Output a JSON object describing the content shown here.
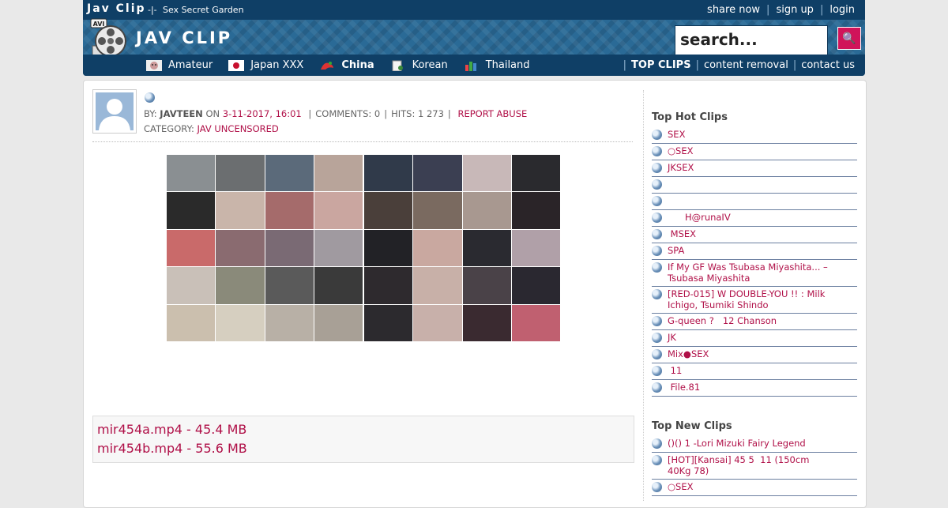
{
  "site": {
    "title": "Jav Clip",
    "separator": "-|-",
    "tagline": "Sex Secret Garden",
    "logo_text": "JAV CLIP",
    "logo_badge": "AVI"
  },
  "top_links": [
    "share now",
    "sign up",
    "login"
  ],
  "search": {
    "placeholder": "search..."
  },
  "nav": {
    "items": [
      {
        "label": "Amateur",
        "icon": "amateur-icon",
        "bold": false
      },
      {
        "label": "Japan XXX",
        "icon": "japan-flag-icon",
        "bold": false
      },
      {
        "label": "China",
        "icon": "china-icon",
        "bold": true
      },
      {
        "label": "Korean",
        "icon": "korean-icon",
        "bold": false
      },
      {
        "label": "Thailand",
        "icon": "thailand-icon",
        "bold": false
      }
    ],
    "right": [
      "TOP CLIPS",
      "content removal",
      "contact us"
    ]
  },
  "post": {
    "by_label": "BY:",
    "author": "JAVTEEN",
    "on_label": "ON",
    "date": "3-11-2017, 16:01",
    "comments": "COMMENTS: 0",
    "hits": "HITS: 1 273",
    "report": "REPORT ABUSE",
    "category_label": "CATEGORY:",
    "category": "JAV UNCENSORED"
  },
  "files": [
    "mir454a.mp4 - 45.4 MB",
    "mir454b.mp4 - 55.6 MB"
  ],
  "sidebar": {
    "hot_title": "Top Hot Clips",
    "hot": [
      "SEX",
      "○SEX",
      "JKSEX",
      "",
      "",
      "      H@runaIV",
      " MSEX",
      "SPA",
      "If My GF Was Tsubasa Miyashita... – Tsubasa Miyashita",
      "[RED-015] W DOUBLE-YOU !! : Milk Ichigo, Tsumiki Shindo",
      "G-queen ?   12 Chanson",
      "JK",
      "Mix●SEX",
      " 11",
      " File.81"
    ],
    "new_title": "Top New Clips",
    "new": [
      "()() 1 -Lori Mizuki Fairy Legend",
      "[HOT][Kansai] 45 5  11 (150cm 40Kg 78)",
      "○SEX"
    ]
  },
  "colors": {
    "header": "#1d5a86",
    "topbar": "#0f3f66",
    "accent": "#d0145a",
    "link": "#b01048"
  }
}
